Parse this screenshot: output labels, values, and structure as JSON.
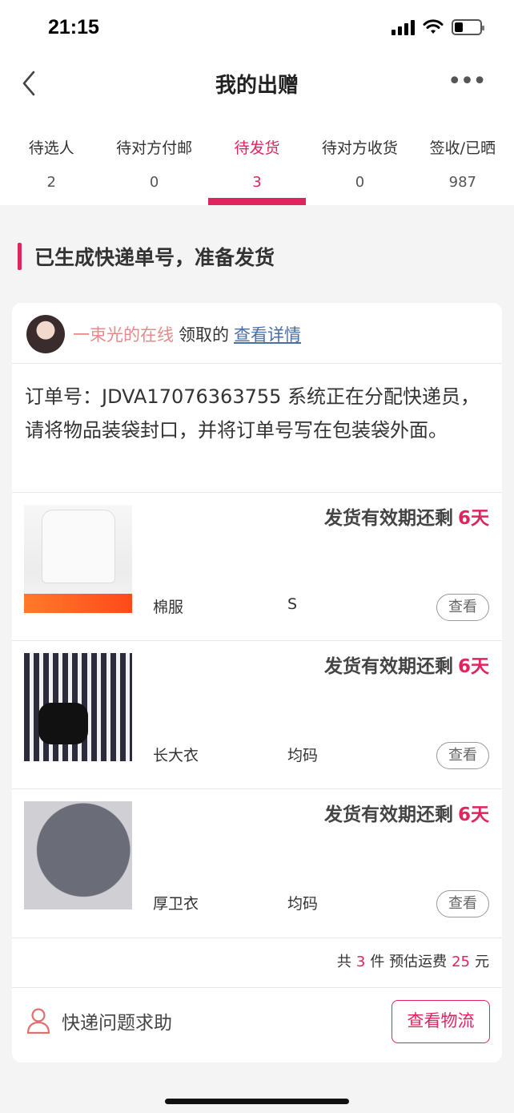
{
  "status_bar": {
    "time": "21:15"
  },
  "nav": {
    "title": "我的出赠"
  },
  "tabs": [
    {
      "label": "待选人",
      "count": "2"
    },
    {
      "label": "待对方付邮",
      "count": "0"
    },
    {
      "label": "待发货",
      "count": "3"
    },
    {
      "label": "待对方收货",
      "count": "0"
    },
    {
      "label": "签收/已晒",
      "count": "987"
    }
  ],
  "active_tab_index": 2,
  "section": {
    "title": "已生成快递单号，准备发货"
  },
  "card": {
    "claimer_name": "一束光的在线",
    "claimer_verb": "领取的",
    "detail_link": "查看详情",
    "order_note": "订单号：JDVA17076363755 系统正在分配快递员，请将物品装袋封口，并将订单号写在包装袋外面。",
    "items": [
      {
        "deadline_label": "发货有效期还剩",
        "days": "6天",
        "name": "棉服",
        "size": "S",
        "view": "查看"
      },
      {
        "deadline_label": "发货有效期还剩",
        "days": "6天",
        "name": "长大衣",
        "size": "均码",
        "view": "查看"
      },
      {
        "deadline_label": "发货有效期还剩",
        "days": "6天",
        "name": "厚卫衣",
        "size": "均码",
        "view": "查看"
      }
    ],
    "summary": {
      "prefix": "共",
      "count": "3",
      "mid": "件 预估运费",
      "fee": "25",
      "suffix": "元"
    },
    "help_label": "快递问题求助",
    "track_button": "查看物流"
  },
  "colors": {
    "accent": "#e0245e",
    "link": "#4a6fa5",
    "claimer_name": "#e68a8a"
  },
  "icons": [
    "back-arrow-icon",
    "more-icon",
    "signal-icon",
    "wifi-icon",
    "battery-icon",
    "person-icon"
  ]
}
